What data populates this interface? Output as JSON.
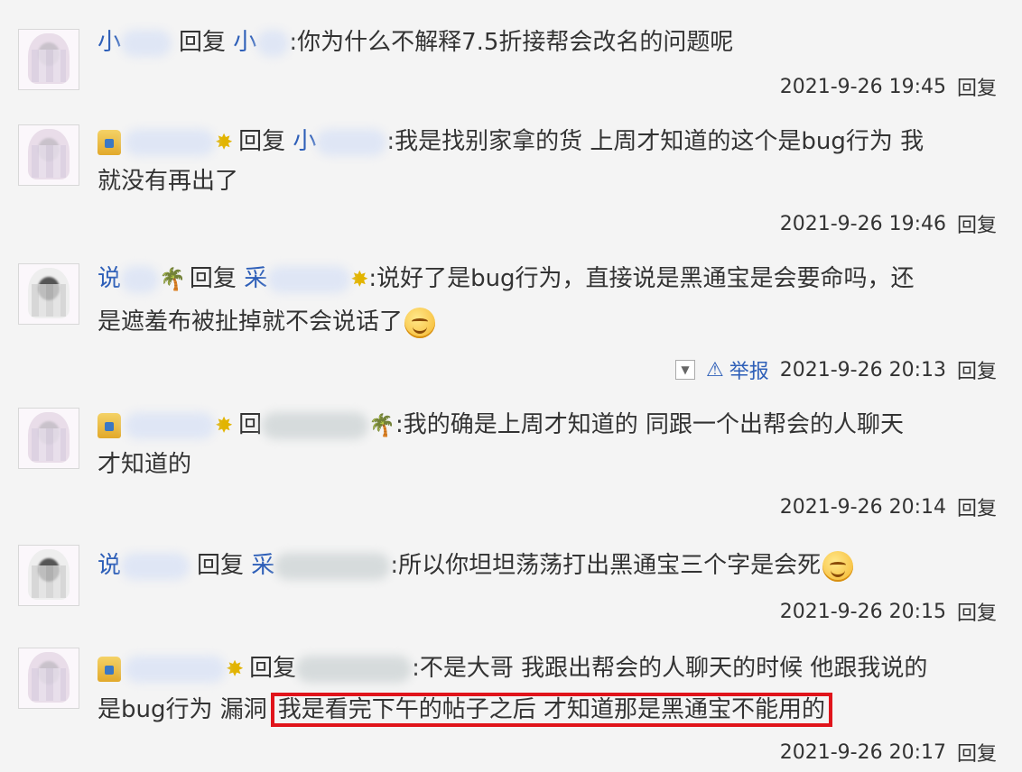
{
  "comments": [
    {
      "prefix": "小",
      "reply_word": "回复",
      "reply_to": "小",
      "text": ":你为什么不解释7.5折接帮会改名的问题呢",
      "time": "2021-9-26 19:45",
      "reply_label": "回复"
    },
    {
      "reply_word": "回复",
      "reply_to": "小",
      "text": ":我是找别家拿的货 上周才知道的这个是bug行为 我",
      "cont": "就没有再出了",
      "time": "2021-9-26 19:46",
      "reply_label": "回复"
    },
    {
      "prefix": "说",
      "reply_word": "回复",
      "reply_to": "采",
      "text": ":说好了是bug行为，直接说是黑通宝是会要命吗，还",
      "cont": "是遮羞布被扯掉就不会说话了",
      "report_label": "举报",
      "time": "2021-9-26 20:13",
      "reply_label": "回复"
    },
    {
      "reply_word": "回",
      "text": ":我的确是上周才知道的 同跟一个出帮会的人聊天",
      "cont": "才知道的",
      "time": "2021-9-26 20:14",
      "reply_label": "回复"
    },
    {
      "prefix": "说",
      "reply_word": "回复",
      "reply_to": "采",
      "text": ":所以你坦坦荡荡打出黑通宝三个字是会死",
      "time": "2021-9-26 20:15",
      "reply_label": "回复"
    },
    {
      "reply_word": "回复",
      "text": ":不是大哥 我跟出帮会的人聊天的时候 他跟我说的",
      "cont_a": "是bug行为 漏洞",
      "cont_b": "我是看完下午的帖子之后 才知道那是黑通宝不能用的",
      "time": "2021-9-26 20:17",
      "reply_label": "回复"
    }
  ],
  "colors": {
    "link": "#2e5fb8",
    "highlight": "#e0141b"
  },
  "icons": {
    "crown": "crown-icon",
    "star": "star-badge-icon",
    "palm": "palm-icon",
    "emoji": "smile-emoji-icon",
    "warn": "warning-icon"
  }
}
